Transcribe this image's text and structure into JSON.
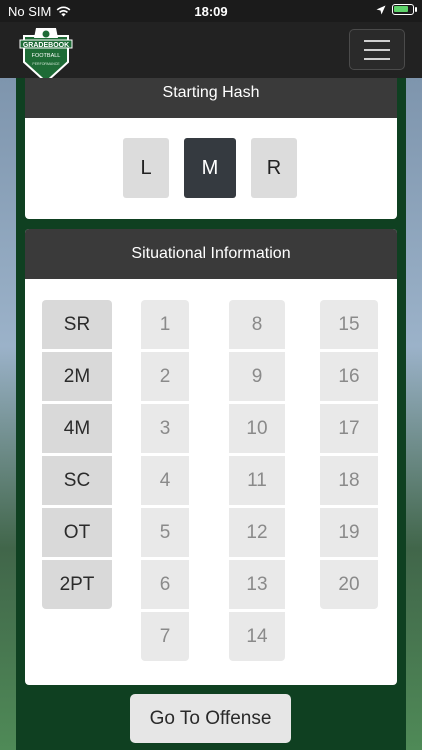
{
  "status_bar": {
    "carrier": "No SIM",
    "time": "18:09",
    "battery_level": 0.8
  },
  "nav": {
    "logo_text_top": "GRADEBOOK",
    "logo_text_mid": "FOOTBALL",
    "logo_text_bot": "PERFORMANCE"
  },
  "starting_hash": {
    "title": "Starting Hash",
    "options": [
      "L",
      "M",
      "R"
    ],
    "selected": "M"
  },
  "situational": {
    "title": "Situational Information",
    "situations": [
      "SR",
      "2M",
      "4M",
      "SC",
      "OT",
      "2PT"
    ],
    "col1": [
      "1",
      "2",
      "3",
      "4",
      "5",
      "6",
      "7"
    ],
    "col2": [
      "8",
      "9",
      "10",
      "11",
      "12",
      "13",
      "14"
    ],
    "col3": [
      "15",
      "16",
      "17",
      "18",
      "19",
      "20"
    ]
  },
  "actions": {
    "go_to_offense": "Go To Offense"
  },
  "colors": {
    "header": "#3a3a3a",
    "selected": "#353a40",
    "green": "#0f4021"
  }
}
